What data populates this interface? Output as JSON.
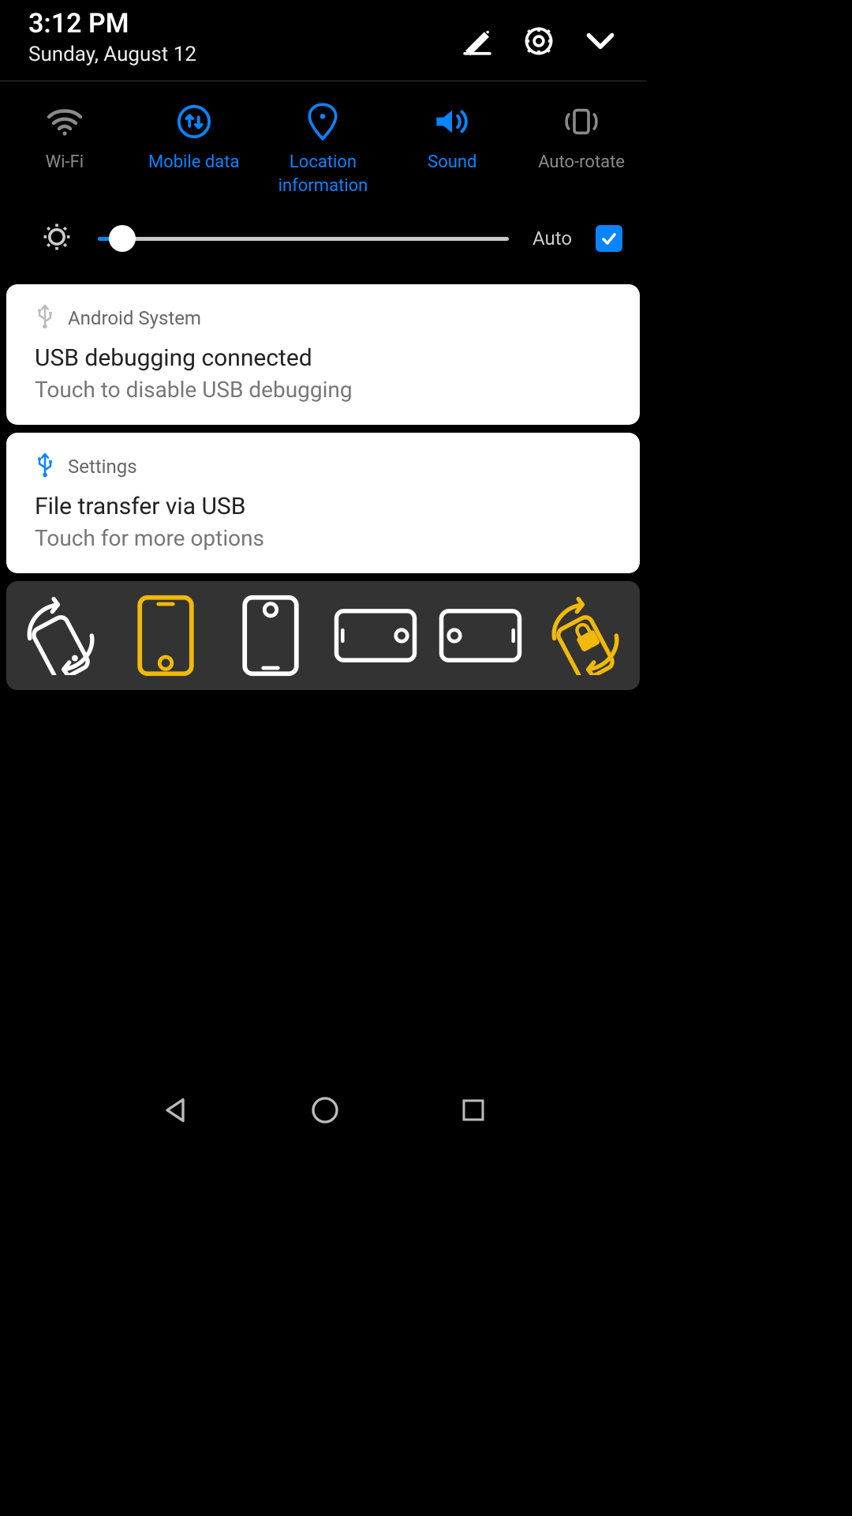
{
  "header": {
    "time": "3:12 PM",
    "date": "Sunday, August 12"
  },
  "quick_settings": {
    "tiles": [
      {
        "label": "Wi-Fi",
        "active": false
      },
      {
        "label": "Mobile data",
        "active": true
      },
      {
        "label": "Location information",
        "active": true
      },
      {
        "label": "Sound",
        "active": true
      },
      {
        "label": "Auto-rotate",
        "active": false
      }
    ]
  },
  "brightness": {
    "percent": 6,
    "auto_label": "Auto",
    "auto_checked": true
  },
  "notifications": [
    {
      "app": "Android System",
      "title": "USB debugging connected",
      "subtitle": "Touch to disable USB debugging",
      "icon_color": "#bbbbbb"
    },
    {
      "app": "Settings",
      "title": "File transfer via USB",
      "subtitle": "Touch for more options",
      "icon_color": "#0a84ff"
    }
  ],
  "orientation_bar": {
    "selected_index": 1
  },
  "colors": {
    "accent": "#0a84ff",
    "highlight": "#f0b90b",
    "inactive": "#8a8a8a"
  }
}
